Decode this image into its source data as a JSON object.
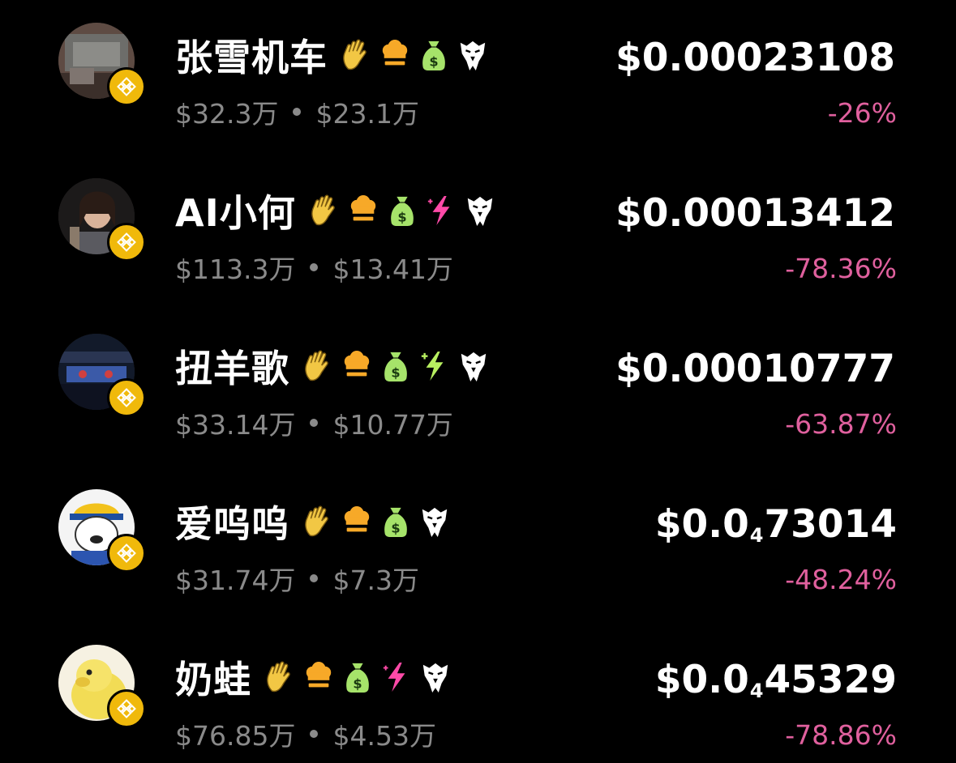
{
  "colors": {
    "background": "#000000",
    "negative_change": "#e0609e",
    "muted_text": "#8a8a8a",
    "chain_badge": "#f0b90b",
    "tag_wave": "#f2c744",
    "tag_chef": "#f7a928",
    "tag_money": "#a6e36a",
    "tag_bolt_pink": "#ff4aa8",
    "tag_bolt_green": "#b8f060",
    "tag_eagle": "#ffffff"
  },
  "tokens": [
    {
      "name": "张雪机车",
      "market_cap": "$32.3万",
      "liquidity": "$23.1万",
      "price_prefix": "$0.00023108",
      "price_zero_count": "",
      "price_digits": "",
      "change": "-26%",
      "tags": [
        "wave-icon",
        "chef-hat-icon",
        "money-bag-icon",
        "eagle-icon"
      ]
    },
    {
      "name": "AI小何",
      "market_cap": "$113.3万",
      "liquidity": "$13.41万",
      "price_prefix": "$0.00013412",
      "price_zero_count": "",
      "price_digits": "",
      "change": "-78.36%",
      "tags": [
        "wave-icon",
        "chef-hat-icon",
        "money-bag-icon",
        "bolt-pink-icon",
        "eagle-icon"
      ]
    },
    {
      "name": "扭羊歌",
      "market_cap": "$33.14万",
      "liquidity": "$10.77万",
      "price_prefix": "$0.00010777",
      "price_zero_count": "",
      "price_digits": "",
      "change": "-63.87%",
      "tags": [
        "wave-icon",
        "chef-hat-icon",
        "money-bag-icon",
        "bolt-green-icon",
        "eagle-icon"
      ]
    },
    {
      "name": "爱呜呜",
      "market_cap": "$31.74万",
      "liquidity": "$7.3万",
      "price_prefix": "$0.0",
      "price_zero_count": "4",
      "price_digits": "73014",
      "change": "-48.24%",
      "tags": [
        "wave-icon",
        "chef-hat-icon",
        "money-bag-icon",
        "eagle-icon"
      ]
    },
    {
      "name": "奶蛙",
      "market_cap": "$76.85万",
      "liquidity": "$4.53万",
      "price_prefix": "$0.0",
      "price_zero_count": "4",
      "price_digits": "45329",
      "change": "-78.86%",
      "tags": [
        "wave-icon",
        "chef-hat-icon",
        "money-bag-icon",
        "bolt-pink-icon",
        "eagle-icon"
      ]
    }
  ]
}
